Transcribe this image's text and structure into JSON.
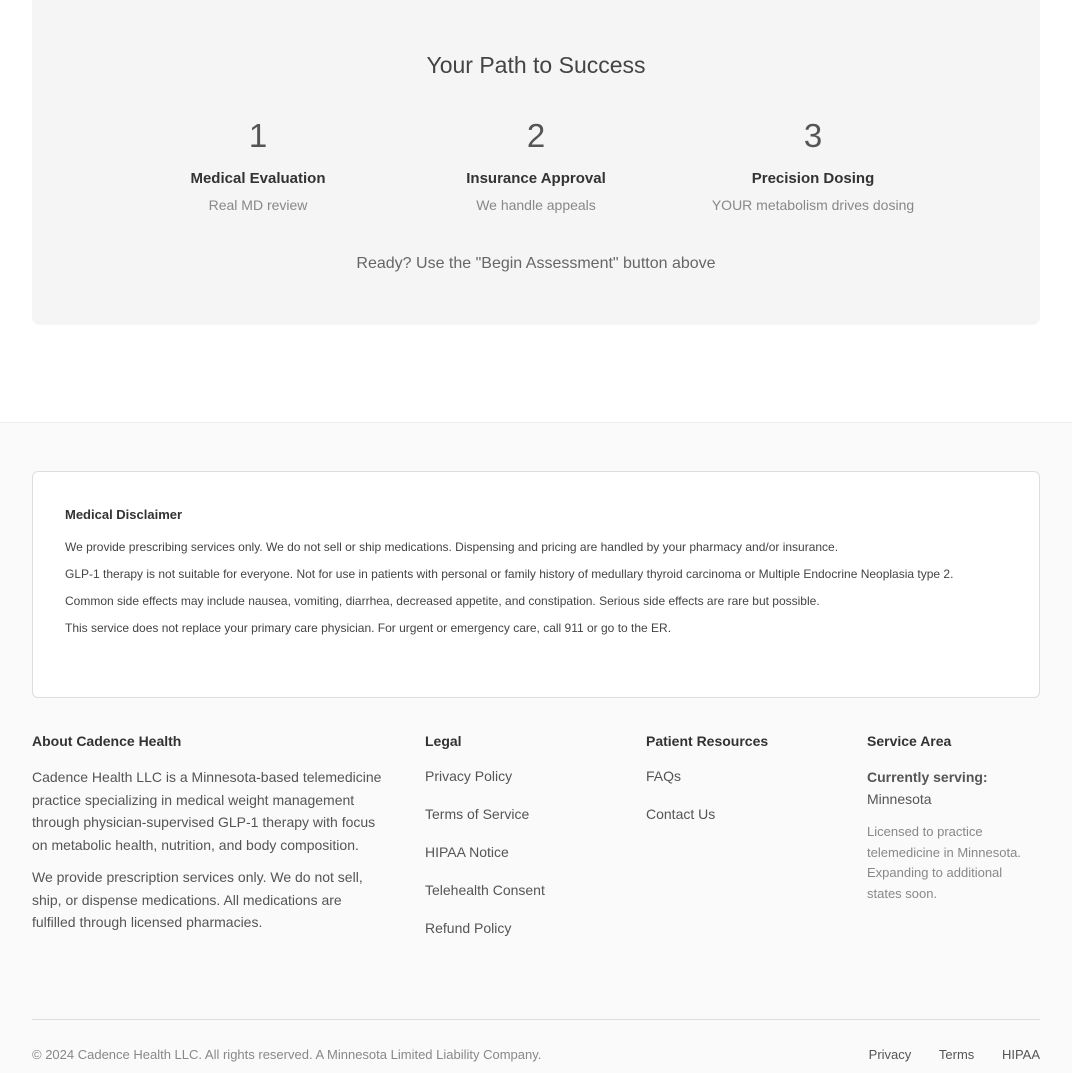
{
  "steps": {
    "title": "Your Path to Success",
    "items": [
      {
        "number": "1",
        "title": "Medical Evaluation",
        "subtitle": "Real MD review"
      },
      {
        "number": "2",
        "title": "Insurance Approval",
        "subtitle": "We handle appeals"
      },
      {
        "number": "3",
        "title": "Precision Dosing",
        "subtitle": "YOUR metabolism drives dosing"
      }
    ],
    "cta_text": "Ready? Use the \"Begin Assessment\" button above"
  },
  "disclaimer": {
    "title": "Medical Disclaimer",
    "lines": [
      "We provide prescribing services only. We do not sell or ship medications. Dispensing and pricing are handled by your pharmacy and/or insurance.",
      "GLP-1 therapy is not suitable for everyone. Not for use in patients with personal or family history of medullary thyroid carcinoma or Multiple Endocrine Neoplasia type 2.",
      "Common side effects may include nausea, vomiting, diarrhea, decreased appetite, and constipation. Serious side effects are rare but possible.",
      "This service does not replace your primary care physician. For urgent or emergency care, call 911 or go to the ER."
    ]
  },
  "footer": {
    "about": {
      "title": "About Cadence Health",
      "paragraphs": [
        "Cadence Health LLC is a Minnesota-based telemedicine practice specializing in medical weight management through physician-supervised GLP-1 therapy with focus on metabolic health, nutrition, and body composition.",
        "We provide prescription services only. We do not sell, ship, or dispense medications. All medications are fulfilled through licensed pharmacies."
      ]
    },
    "legal": {
      "title": "Legal",
      "links": [
        "Privacy Policy",
        "Terms of Service",
        "HIPAA Notice",
        "Telehealth Consent",
        "Refund Policy"
      ]
    },
    "resources": {
      "title": "Patient Resources",
      "links": [
        "FAQs",
        "Contact Us"
      ]
    },
    "service_area": {
      "title": "Service Area",
      "serving_label": "Currently serving:",
      "serving_value": "Minnesota",
      "note": "Licensed to practice telemedicine in Minnesota. Expanding to additional states soon."
    },
    "copyright": "© 2024 Cadence Health LLC. All rights reserved. A Minnesota Limited Liability Company.",
    "bottom_links": [
      "Privacy",
      "Terms",
      "HIPAA"
    ]
  }
}
